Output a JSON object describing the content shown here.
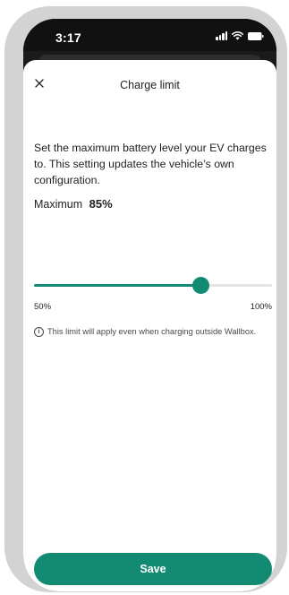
{
  "status_bar": {
    "time": "3:17",
    "icons": [
      "signal-icon",
      "wifi-icon",
      "battery-icon"
    ]
  },
  "sheet": {
    "title": "Charge limit",
    "close_icon": "close-icon",
    "description": "Set the maximum battery level your EV charges to. This setting updates the vehicle’s own configuration.",
    "maximum_label": "Maximum",
    "maximum_value": "85%",
    "slider": {
      "min_label": "50%",
      "max_label": "100%",
      "min": 50,
      "max": 100,
      "value": 85
    },
    "info_icon": "info-icon",
    "info_text": "This limit will apply even when charging outside Wallbox.",
    "save_label": "Save"
  },
  "colors": {
    "accent": "#138a72",
    "track": "#e4e4e4",
    "frame": "#d3d3d3",
    "screen": "#111111"
  }
}
